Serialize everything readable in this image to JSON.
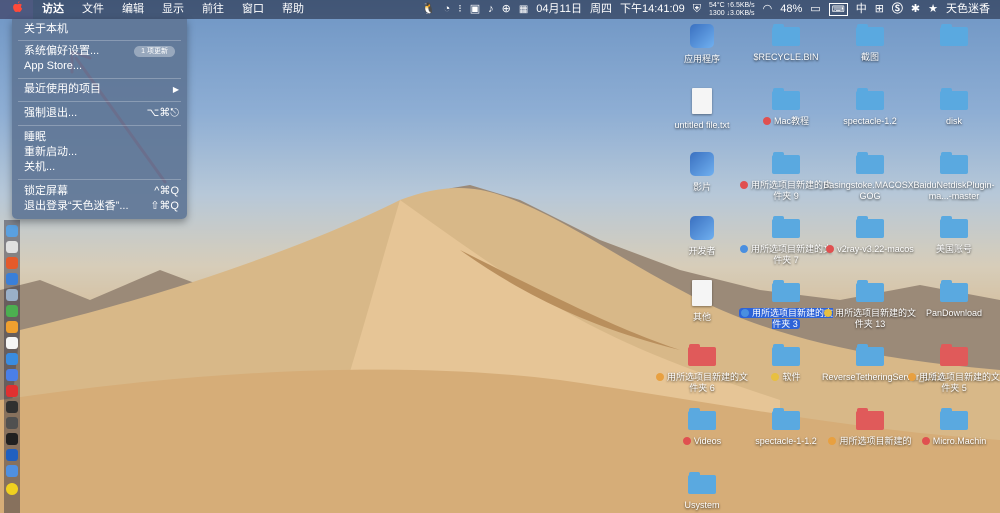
{
  "menubar": {
    "apple_icon": "apple-logo-icon",
    "items": [
      "访达",
      "文件",
      "编辑",
      "显示",
      "前往",
      "窗口",
      "帮助"
    ],
    "status": {
      "date": "04月11日",
      "weekday": "周四",
      "time": "下午14:41:09",
      "temp_upload": "54°C ↑6.5KB/s",
      "fan_download": "1300 ↓3.0KB/s",
      "battery": "48%",
      "input_method": "中",
      "user": "天色迷香"
    }
  },
  "apple_menu": {
    "about": "关于本机",
    "system_prefs": "系统偏好设置...",
    "update_badge": "1 项更新",
    "app_store": "App Store...",
    "recent_items": "最近使用的项目",
    "recent_arrow": "▶",
    "force_quit": "强制退出...",
    "force_quit_shortcut": "⌥⌘⎋",
    "sleep": "睡眠",
    "restart": "重新启动...",
    "shutdown": "关机...",
    "lock_screen": "锁定屏幕",
    "lock_shortcut": "^⌘Q",
    "logout": "退出登录“天色迷香”...",
    "logout_shortcut": "⇧⌘Q"
  },
  "desktop_icons": [
    {
      "label": "应用程序",
      "kind": "app"
    },
    {
      "label": "$RECYCLE.BIN",
      "kind": "folder"
    },
    {
      "label": "截图",
      "kind": "folder"
    },
    {
      "label": "",
      "kind": "folder"
    },
    {
      "label": "untitled file.txt",
      "kind": "file"
    },
    {
      "label": "Mac教程",
      "kind": "folder",
      "tag": "#e05050"
    },
    {
      "label": "spectacle-1.2",
      "kind": "folder"
    },
    {
      "label": "disk",
      "kind": "folder"
    },
    {
      "label": "影片",
      "kind": "app"
    },
    {
      "label": "用所选项目新建的文件夹 9",
      "kind": "folder",
      "tag": "#e05050"
    },
    {
      "label": "Basingstoke.MACOSX-GOG",
      "kind": "folder"
    },
    {
      "label": "BaiduNetdiskPlugin-ma...-master",
      "kind": "folder"
    },
    {
      "label": "开发者",
      "kind": "app"
    },
    {
      "label": "用所选项目新建的文件夹 7",
      "kind": "folder",
      "tag": "#4a8fe0"
    },
    {
      "label": "v2ray-v3.22-macos",
      "kind": "folder",
      "tag": "#e05050"
    },
    {
      "label": "美国账号",
      "kind": "folder"
    },
    {
      "label": "其他",
      "kind": "file"
    },
    {
      "label": "用所选项目新建的文件夹 3",
      "kind": "folder",
      "tag": "#4a8fe0"
    },
    {
      "label": "用所选项目新建的文件夹 13",
      "kind": "folder",
      "tag": "#e8c040"
    },
    {
      "label": "PanDownload",
      "kind": "folder"
    },
    {
      "label": "用所选项目新建的文件夹 6",
      "kind": "folder",
      "tag": "#e8a040"
    },
    {
      "label": "软件",
      "kind": "folder",
      "tag": "#e8c040"
    },
    {
      "label": "ReverseTetheringServer_1.2.0",
      "kind": "folder"
    },
    {
      "label": "用所选项目新建的文件夹 5",
      "kind": "folder",
      "tag": "#e8a040"
    },
    {
      "label": "Videos",
      "kind": "folder",
      "tag": "#e05050"
    },
    {
      "label": "spectacle-1-1.2",
      "kind": "folder"
    },
    {
      "label": "用所选项目新建的",
      "kind": "folder",
      "tag": "#e8a040"
    },
    {
      "label": "Micro.Machin",
      "kind": "folder",
      "tag": "#e05050"
    },
    {
      "label": "Usystem",
      "kind": "folder"
    }
  ],
  "colors": {
    "folder_blue": "#5aa9e0",
    "folder_red": "#e05a5a",
    "arrow": "#e0202a",
    "selection": "#2d63d8"
  }
}
